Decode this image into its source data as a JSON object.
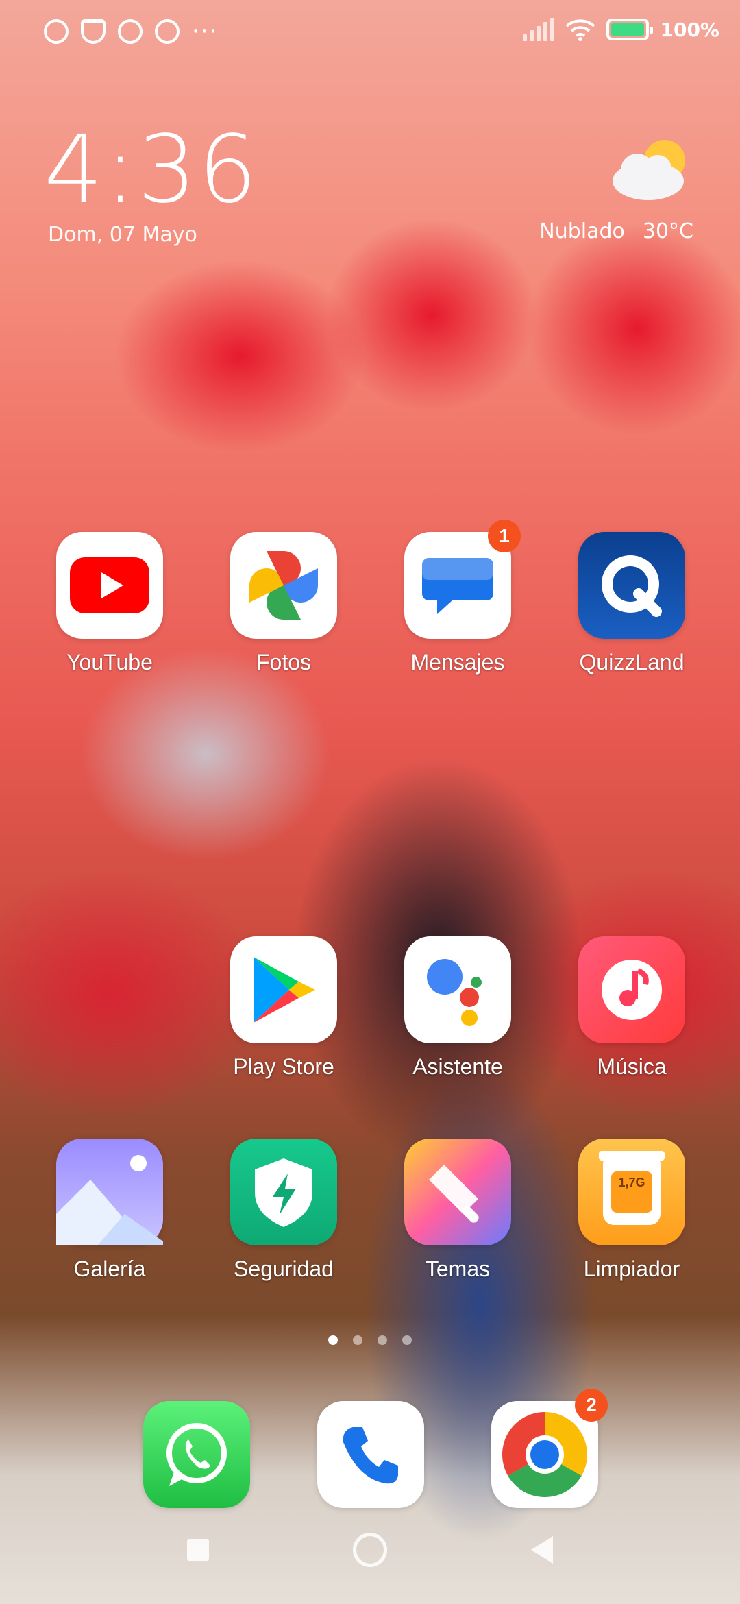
{
  "status_bar": {
    "battery_text": "100%",
    "battery_level": 1.0,
    "icons": [
      "alarm-icon",
      "notification-icon",
      "sync-icon",
      "sync-icon-2",
      "more-dots-icon",
      "signal-icon",
      "wifi-icon",
      "battery-charging-icon"
    ]
  },
  "clock": {
    "time": "4:36",
    "date": "Dom, 07 Mayo"
  },
  "weather": {
    "condition": "Nublado",
    "temperature": "30°C",
    "icon": "partly-cloudy-icon"
  },
  "apps": {
    "row1": [
      {
        "label": "YouTube",
        "icon": "youtube-icon",
        "badge": null
      },
      {
        "label": "Fotos",
        "icon": "photos-icon",
        "badge": null
      },
      {
        "label": "Mensajes",
        "icon": "messages-icon",
        "badge": "1"
      },
      {
        "label": "QuizzLand",
        "icon": "quizzland-icon",
        "badge": null
      }
    ],
    "row2": [
      {
        "label": "Play Store",
        "icon": "play-store-icon"
      },
      {
        "label": "Asistente",
        "icon": "assistant-icon"
      },
      {
        "label": "Música",
        "icon": "music-icon"
      }
    ],
    "row3": [
      {
        "label": "Galería",
        "icon": "gallery-icon"
      },
      {
        "label": "Seguridad",
        "icon": "security-icon"
      },
      {
        "label": "Temas",
        "icon": "themes-icon"
      },
      {
        "label": "Limpiador",
        "icon": "cleaner-icon",
        "icon_text": "1,7G"
      }
    ]
  },
  "dock": [
    {
      "name": "whatsapp",
      "icon": "whatsapp-icon"
    },
    {
      "name": "phone",
      "icon": "phone-icon"
    },
    {
      "name": "chrome",
      "icon": "chrome-icon",
      "badge": "2"
    }
  ],
  "pager": {
    "pages": 4,
    "current": 1
  },
  "colors": {
    "badge": "#f4511e",
    "youtube": "#ff0000",
    "whatsapp": "#25d366",
    "music": "#ff3b5c"
  }
}
